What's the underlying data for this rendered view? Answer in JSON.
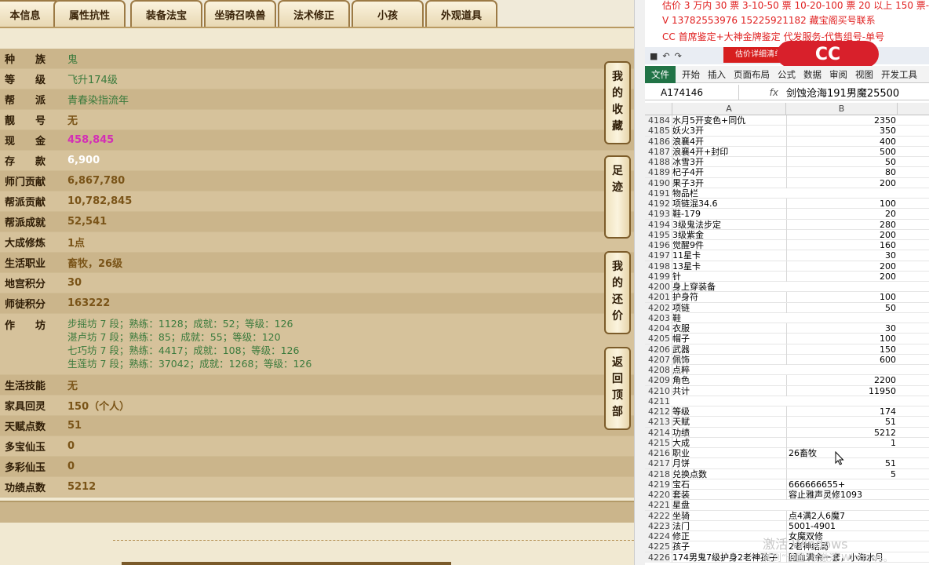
{
  "tabs": [
    "本信息",
    "属性抗性",
    "装备法宝",
    "坐骑召唤兽",
    "法术修正",
    "小孩",
    "外观道具"
  ],
  "rows": [
    {
      "label": "种　　族",
      "value": "鬼",
      "cls": "green"
    },
    {
      "label": "等　　级",
      "value": "飞升174级",
      "cls": "green"
    },
    {
      "label": "帮　　派",
      "value": "青春染指流年",
      "cls": "green"
    },
    {
      "label": "靓　　号",
      "value": "无",
      "cls": "gold"
    },
    {
      "label": "现　　金",
      "value": "458,845",
      "cls": "pink"
    },
    {
      "label": "存　　款",
      "value": "6,900",
      "cls": "white"
    },
    {
      "label": "师门贡献",
      "value": "6,867,780",
      "cls": "gold"
    },
    {
      "label": "帮派贡献",
      "value": "10,782,845",
      "cls": "gold"
    },
    {
      "label": "帮派成就",
      "value": "52,541",
      "cls": "gold"
    },
    {
      "label": "大成修炼",
      "value": "1点",
      "cls": "gold"
    },
    {
      "label": "生活职业",
      "value": "畜牧，26级",
      "cls": "gold"
    },
    {
      "label": "地宫积分",
      "value": "30",
      "cls": "gold"
    },
    {
      "label": "师徒积分",
      "value": "163222",
      "cls": "gold"
    }
  ],
  "workshop": {
    "label": "作　　坊",
    "lines": [
      "步摇坊 7 段；熟练：1128；成就：52；等级：126",
      "湛卢坊 7 段；熟练：85；成就：55；等级：120",
      "七巧坊 7 段；熟练：4417；成就：108；等级：126",
      "生莲坊 7 段；熟练：37042；成就：1268；等级：126"
    ]
  },
  "rows2": [
    {
      "label": "生活技能",
      "value": "无",
      "cls": "gold"
    },
    {
      "label": "家具回灵",
      "value": "150（个人）",
      "cls": "gold"
    },
    {
      "label": "天赋点数",
      "value": "51",
      "cls": "gold"
    },
    {
      "label": "多宝仙玉",
      "value": "0",
      "cls": "gold"
    },
    {
      "label": "多彩仙玉",
      "value": "0",
      "cls": "gold"
    },
    {
      "label": "功绩点数",
      "value": "5212",
      "cls": "gold"
    }
  ],
  "side_buttons": [
    "我的收藏",
    "足迹",
    "我的还价",
    "返回顶部"
  ],
  "excel": {
    "ann_lines": [
      "估价 3 万内 30 票  3-10-50 票 10-20-100 票 20 以上 150 票-1 票 1 元",
      "V 13782553976   15225921182  藏宝阁买号联系",
      "CC 首席鉴定+大神金牌鉴定 代发服务-代售组号-单号"
    ],
    "logo": "CC",
    "redbar": "估价详细清单",
    "ribbon": [
      "文件",
      "开始",
      "插入",
      "页面布局",
      "公式",
      "数据",
      "审阅",
      "视图",
      "开发工具"
    ],
    "namebox": "A174146",
    "fx": "fx",
    "formula": "剑蚀沧海191男魔25500",
    "col_a": "A",
    "col_b": "B",
    "rows": [
      [
        "4184",
        "水月5开变色+同仇",
        "2350"
      ],
      [
        "4185",
        "妖火3开",
        "350"
      ],
      [
        "4186",
        "浪襄4开",
        "400"
      ],
      [
        "4187",
        "浪襄4开+封印",
        "500"
      ],
      [
        "4188",
        "冰雪3开",
        "50"
      ],
      [
        "4189",
        "杞子4开",
        "80"
      ],
      [
        "4190",
        "果子3开",
        "200"
      ],
      [
        "4191",
        "物品栏",
        ""
      ],
      [
        "4192",
        "项链混34.6",
        "100"
      ],
      [
        "4193",
        "鞋-179",
        "20"
      ],
      [
        "4194",
        "3级鬼法步定",
        "280"
      ],
      [
        "4195",
        "3级紫金",
        "200"
      ],
      [
        "4196",
        "觉醒9件",
        "160"
      ],
      [
        "4197",
        "11星卡",
        "30"
      ],
      [
        "4198",
        "13星卡",
        "200"
      ],
      [
        "4199",
        "针",
        "200"
      ],
      [
        "4200",
        "身上穿装备",
        ""
      ],
      [
        "4201",
        "护身符",
        "100"
      ],
      [
        "4202",
        "项链",
        "50"
      ],
      [
        "4203",
        "鞋",
        ""
      ],
      [
        "4204",
        "衣服",
        "30"
      ],
      [
        "4205",
        "帽子",
        "100"
      ],
      [
        "4206",
        "武器",
        "150"
      ],
      [
        "4207",
        "佩饰",
        "600"
      ],
      [
        "4208",
        "点粹",
        ""
      ],
      [
        "4209",
        "角色",
        "2200"
      ],
      [
        "4210",
        "共计",
        "11950"
      ],
      [
        "4211",
        "",
        ""
      ],
      [
        "4212",
        "等级",
        "174"
      ],
      [
        "4213",
        "天赋",
        "51"
      ],
      [
        "4214",
        "功绩",
        "5212"
      ],
      [
        "4215",
        "大成",
        "1"
      ],
      [
        "4216",
        "职业",
        "26畜牧"
      ],
      [
        "4217",
        "月饼",
        "51"
      ],
      [
        "4218",
        "兑换点数",
        "5"
      ],
      [
        "4219",
        "宝石",
        "666666655+"
      ],
      [
        "4220",
        "套装",
        "容止雅声灵修1093"
      ],
      [
        "4221",
        "星盘",
        ""
      ],
      [
        "4222",
        "坐骑",
        "点4满2人6魔7"
      ],
      [
        "4223",
        "法门",
        "5001-4901"
      ],
      [
        "4224",
        "修正",
        "女魔双修"
      ],
      [
        "4225",
        "孩子",
        "2老神结局"
      ],
      [
        "4226",
        "174男鬼7级护身2老神孩子",
        "回血满余一套，小海水月"
      ]
    ],
    "watermark1": "激活 Windows",
    "watermark2": "转到“设置”以激活 Windows。"
  }
}
